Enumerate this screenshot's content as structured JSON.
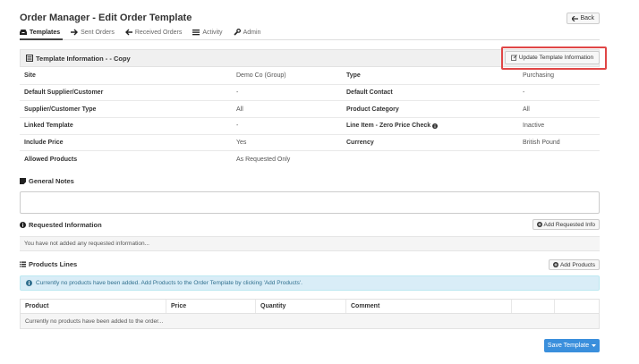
{
  "page": {
    "title": "Order Manager - Edit Order Template",
    "back_label": "Back"
  },
  "tabs": [
    {
      "label": "Templates",
      "active": true
    },
    {
      "label": "Sent Orders",
      "active": false
    },
    {
      "label": "Received Orders",
      "active": false
    },
    {
      "label": "Activity",
      "active": false
    },
    {
      "label": "Admin",
      "active": false
    }
  ],
  "template_info": {
    "title": "Template Information - - Copy",
    "update_button": "Update Template Information",
    "rows": [
      {
        "label1": "Site",
        "value1": "Demo Co (Group)",
        "label2": "Type",
        "value2": "Purchasing"
      },
      {
        "label1": "Default Supplier/Customer",
        "value1": "-",
        "label2": "Default Contact",
        "value2": "-"
      },
      {
        "label1": "Supplier/Customer Type",
        "value1": "All",
        "label2": "Product Category",
        "value2": "All"
      },
      {
        "label1": "Linked Template",
        "value1": "-",
        "label2": "Line Item - Zero Price Check",
        "value2": "Inactive"
      },
      {
        "label1": "Include Price",
        "value1": "Yes",
        "label2": "Currency",
        "value2": "British Pound"
      },
      {
        "label1": "Allowed Products",
        "value1": "As Requested Only",
        "label2": "",
        "value2": ""
      }
    ]
  },
  "general_notes": {
    "title": "General Notes",
    "value": ""
  },
  "requested_info": {
    "title": "Requested Information",
    "add_button": "Add Requested Info",
    "empty_text": "You have not added any requested information..."
  },
  "products": {
    "title": "Products Lines",
    "add_button": "Add Products",
    "alert": "Currently no products have been added. Add Products to the Order Template by clicking 'Add Products'.",
    "columns": [
      "Product",
      "Price",
      "Quantity",
      "Comment",
      "",
      ""
    ],
    "empty_text": "Currently no products have been added to the order..."
  },
  "save_button": "Save Template",
  "colors": {
    "primary": "#3a8fdc",
    "highlight": "#e04646",
    "alert_bg": "#d9edf7",
    "alert_text": "#31708f"
  }
}
